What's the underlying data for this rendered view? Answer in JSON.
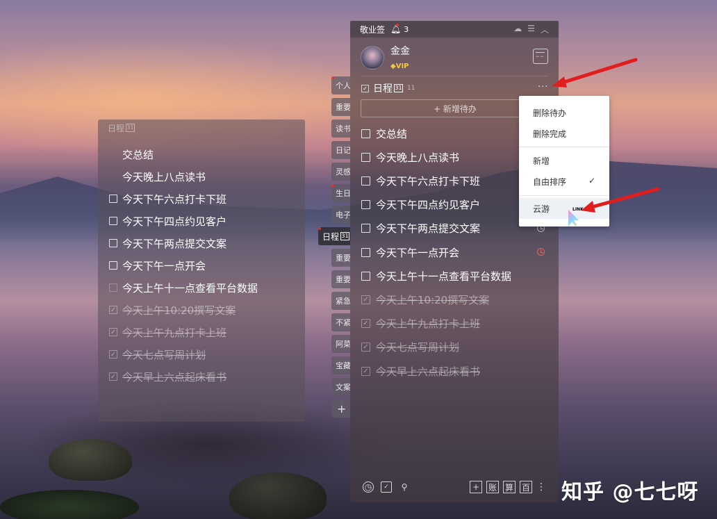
{
  "left_panel": {
    "header": "日程",
    "cal_day": "31",
    "items": [
      {
        "text": "交总结",
        "state": "none"
      },
      {
        "text": "今天晚上八点读书",
        "state": "none"
      },
      {
        "text": "今天下午六点打卡下班",
        "state": "open"
      },
      {
        "text": "今天下午四点约见客户",
        "state": "open"
      },
      {
        "text": "今天下午两点提交文案",
        "state": "open"
      },
      {
        "text": "今天下午一点开会",
        "state": "open"
      },
      {
        "text": "今天上午十一点查看平台数据",
        "state": "open"
      },
      {
        "text": "今天上午10:20撰写文案",
        "state": "done"
      },
      {
        "text": "今天上午九点打卡上班",
        "state": "done"
      },
      {
        "text": "今天七点写周计划",
        "state": "done"
      },
      {
        "text": "今天早上六点起床看书",
        "state": "done"
      }
    ]
  },
  "tabs": [
    {
      "label": "个人",
      "dot": true
    },
    {
      "label": "重要",
      "dot": false
    },
    {
      "label": "读书",
      "dot": false
    },
    {
      "label": "日记",
      "dot": false
    },
    {
      "label": "灵感",
      "dot": false
    },
    {
      "label": "生日",
      "dot": true
    },
    {
      "label": "电子",
      "dot": false
    },
    {
      "label": "日程",
      "dot": true,
      "active": true
    },
    {
      "label": "重要",
      "dot": false
    },
    {
      "label": "重要",
      "dot": false
    },
    {
      "label": "紧急",
      "dot": false
    },
    {
      "label": "不紧",
      "dot": false
    },
    {
      "label": "阿菜",
      "dot": false
    },
    {
      "label": "宝藏",
      "dot": false
    },
    {
      "label": "文案",
      "dot": false
    }
  ],
  "add_tab_label": "+",
  "main": {
    "app_name": "敬业签",
    "notif_count": "3",
    "user": {
      "name": "金金",
      "vip": "VIP"
    },
    "section": {
      "title": "日程",
      "cal_day": "31",
      "count": "11"
    },
    "more_label": "···",
    "add_button": "+ 新增待办",
    "items": [
      {
        "text": "交总结",
        "state": "open",
        "clock": ""
      },
      {
        "text": "今天晚上八点读书",
        "state": "open",
        "clock": ""
      },
      {
        "text": "今天下午六点打卡下班",
        "state": "open",
        "clock": ""
      },
      {
        "text": "今天下午四点约见客户",
        "state": "open",
        "clock": ""
      },
      {
        "text": "今天下午两点提交文案",
        "state": "open",
        "clock": "white"
      },
      {
        "text": "今天下午一点开会",
        "state": "open",
        "clock": "red"
      },
      {
        "text": "今天上午十一点查看平台数据",
        "state": "open",
        "clock": ""
      },
      {
        "text": "今天上午10:20撰写文案",
        "state": "done",
        "clock": ""
      },
      {
        "text": "今天上午九点打卡上班",
        "state": "done",
        "clock": ""
      },
      {
        "text": "今天七点写周计划",
        "state": "done",
        "clock": ""
      },
      {
        "text": "今天早上六点起床看书",
        "state": "done",
        "clock": ""
      }
    ],
    "bottom": {
      "add": "+",
      "ledger": "账",
      "calc": "算",
      "hundred": "百",
      "more": "⋮"
    }
  },
  "menu": {
    "delete_todo": "删除待办",
    "delete_done": "删除完成",
    "new": "新增",
    "free_sort": "自由排序",
    "check": "✓",
    "cloud": "云游"
  },
  "cursor_label": "LINK",
  "watermark": "知乎 @七七呀",
  "colors": {
    "accent_red": "#e5332a",
    "vip_gold": "#f5c83a"
  }
}
